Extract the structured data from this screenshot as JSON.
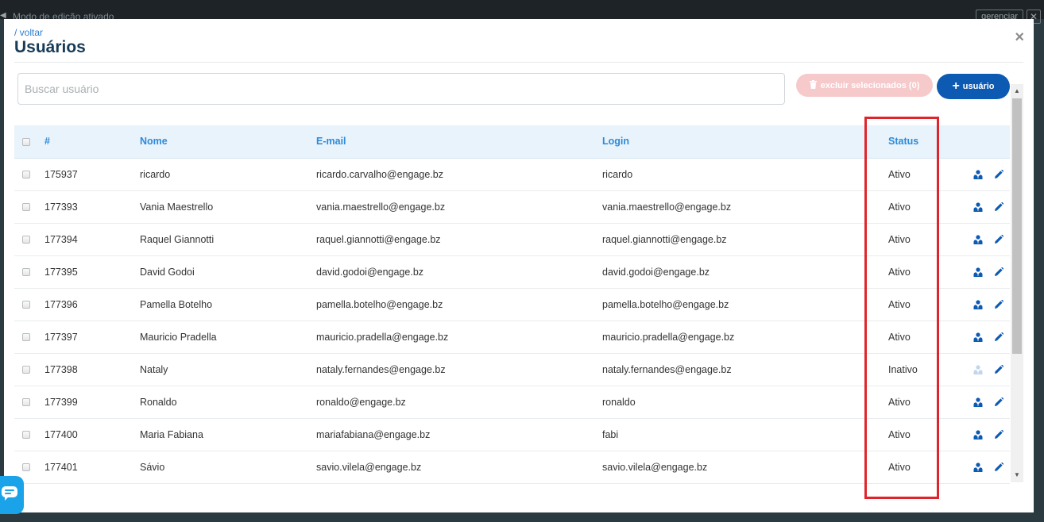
{
  "backdrop": {
    "edit_mode_text": "Modo de edição ativado",
    "manage_label": "gerenciar",
    "close_label": "✕"
  },
  "modal": {
    "back_link": "/ voltar",
    "title": "Usuários",
    "close_symbol": "×"
  },
  "search": {
    "placeholder": "Buscar usuário",
    "value": ""
  },
  "buttons": {
    "delete_selected": "excluir selecionados (0)",
    "add_user": "usuário",
    "add_plus": "+"
  },
  "table": {
    "headers": {
      "id": "#",
      "name": "Nome",
      "email": "E-mail",
      "login": "Login",
      "status": "Status"
    },
    "rows": [
      {
        "id": "175937",
        "name": "ricardo",
        "email": "ricardo.carvalho@engage.bz",
        "login": "ricardo",
        "status": "Ativo",
        "active": true
      },
      {
        "id": "177393",
        "name": "Vania Maestrello",
        "email": "vania.maestrello@engage.bz",
        "login": "vania.maestrello@engage.bz",
        "status": "Ativo",
        "active": true
      },
      {
        "id": "177394",
        "name": "Raquel Giannotti",
        "email": "raquel.giannotti@engage.bz",
        "login": "raquel.giannotti@engage.bz",
        "status": "Ativo",
        "active": true
      },
      {
        "id": "177395",
        "name": "David Godoi",
        "email": "david.godoi@engage.bz",
        "login": "david.godoi@engage.bz",
        "status": "Ativo",
        "active": true
      },
      {
        "id": "177396",
        "name": "Pamella Botelho",
        "email": "pamella.botelho@engage.bz",
        "login": "pamella.botelho@engage.bz",
        "status": "Ativo",
        "active": true
      },
      {
        "id": "177397",
        "name": "Mauricio Pradella",
        "email": "mauricio.pradella@engage.bz",
        "login": "mauricio.pradella@engage.bz",
        "status": "Ativo",
        "active": true
      },
      {
        "id": "177398",
        "name": "Nataly",
        "email": "nataly.fernandes@engage.bz",
        "login": "nataly.fernandes@engage.bz",
        "status": "Inativo",
        "active": false
      },
      {
        "id": "177399",
        "name": "Ronaldo",
        "email": "ronaldo@engage.bz",
        "login": "ronaldo",
        "status": "Ativo",
        "active": true
      },
      {
        "id": "177400",
        "name": "Maria Fabiana",
        "email": "mariafabiana@engage.bz",
        "login": "fabi",
        "status": "Ativo",
        "active": true
      },
      {
        "id": "177401",
        "name": "Sávio",
        "email": "savio.vilela@engage.bz",
        "login": "savio.vilela@engage.bz",
        "status": "Ativo",
        "active": true
      }
    ]
  },
  "icons": {
    "row_user": "user-tie-icon",
    "row_edit": "pencil-icon",
    "delete": "trash-icon",
    "chat": "chat-icon"
  },
  "colors": {
    "primary": "#0d5ab3",
    "header_text": "#2d8ad8",
    "highlight": "#e0242b",
    "delete_disabled": "#f6c9cb"
  }
}
